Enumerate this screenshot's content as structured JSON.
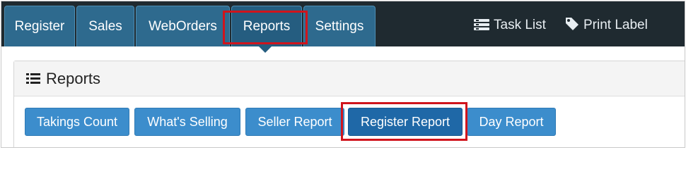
{
  "nav": {
    "tabs": [
      {
        "label": "Register"
      },
      {
        "label": "Sales"
      },
      {
        "label": "WebOrders"
      },
      {
        "label": "Reports",
        "active": true
      },
      {
        "label": "Settings"
      }
    ],
    "links": {
      "task_list": "Task List",
      "print_label": "Print Label"
    }
  },
  "panel": {
    "title": "Reports",
    "buttons": [
      {
        "label": "Takings Count"
      },
      {
        "label": "What's Selling"
      },
      {
        "label": "Seller Report"
      },
      {
        "label": "Register Report",
        "active": true
      },
      {
        "label": "Day Report"
      }
    ]
  },
  "colors": {
    "topbar": "#1f2a30",
    "tab": "#2e6a8e",
    "button": "#3c8dcc",
    "button_active": "#1f68a7",
    "highlight": "#d0141c"
  },
  "icons": {
    "task_list": "task-list-icon",
    "print_label": "tag-icon",
    "reports": "list-icon"
  }
}
